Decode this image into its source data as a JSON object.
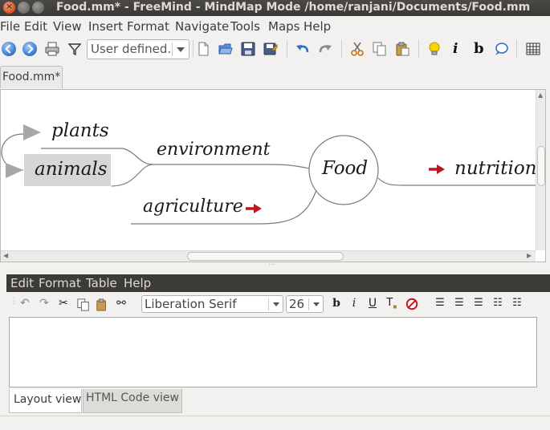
{
  "window": {
    "title": "Food.mm* - FreeMind - MindMap Mode /home/ranjani/Documents/Food.mm"
  },
  "menubar": [
    "File",
    "Edit",
    "View",
    "Insert",
    "Format",
    "Navigate",
    "Tools",
    "Maps",
    "Help"
  ],
  "toolbar": {
    "zoom_value": "User defined.",
    "icons": [
      "back-icon",
      "forward-icon",
      "print-icon",
      "filter-icon",
      "new-document-icon",
      "open-folder-icon",
      "save-icon",
      "save-as-icon",
      "undo-icon",
      "redo-icon",
      "cut-icon",
      "copy-icon",
      "paste-icon",
      "lightbulb-icon",
      "italic-icon",
      "bold-icon",
      "note-bubble-icon",
      "grid-icon"
    ]
  },
  "tabs": [
    "Food.mm*"
  ],
  "mindmap": {
    "root": "Food",
    "nodes": [
      "environment",
      "plants",
      "animals",
      "agriculture",
      "nutrition"
    ],
    "colors": {
      "selected_bg": "#d6d6d6",
      "link_arrow": "#b8191e",
      "edge": "#7a7a7a"
    }
  },
  "editor": {
    "menu": [
      "Edit",
      "Format",
      "Table",
      "Help"
    ],
    "font": "Liberation Serif",
    "size": "26",
    "tabs": [
      "Layout view",
      "HTML Code view"
    ],
    "content": ""
  }
}
